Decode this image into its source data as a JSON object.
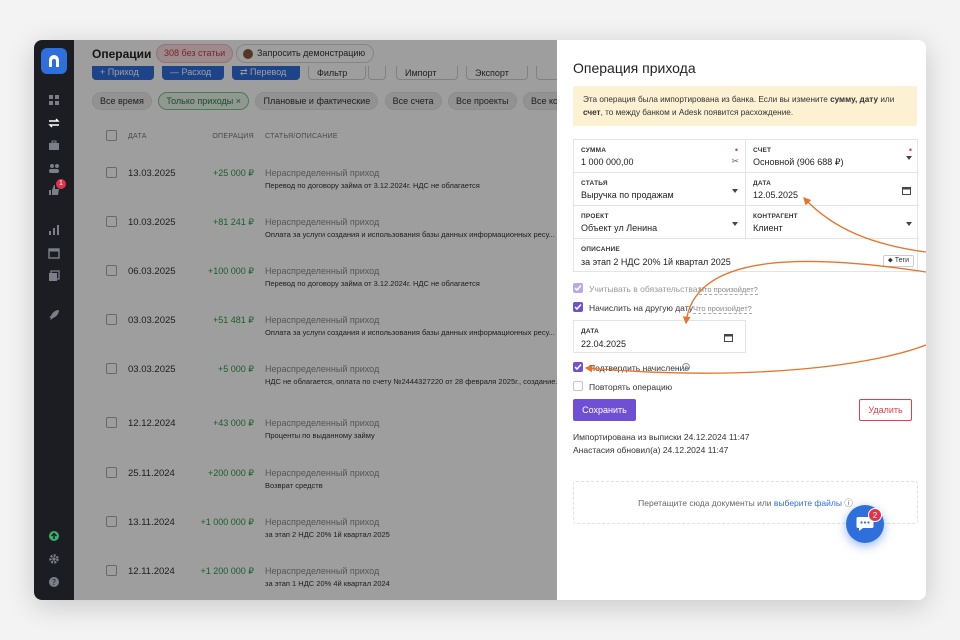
{
  "topbar": {
    "title": "Операции",
    "badge": "308 без статьи",
    "demo_button": "Запросить демонстрацию"
  },
  "toolbar": {
    "buttons": [
      "+ Приход",
      "— Расход",
      "⇄ Перевод",
      "Фильтр",
      "Импорт",
      "Экспорт"
    ]
  },
  "filters": [
    "Все время",
    "Только приходы ×",
    "Плановые и фактические",
    "Все счета",
    "Все проекты",
    "Все контрагенты"
  ],
  "table": {
    "headers": {
      "date": "ДАТА",
      "amount": "ОПЕРАЦИЯ",
      "desc": "СТАТЬЯ/ОПИСАНИЕ"
    },
    "rows": [
      {
        "date": "13.03.2025",
        "amount": "+25 000 ₽",
        "category": "Нераспределенный приход",
        "desc": "Перевод по договору займа от 3.12.2024г. НДС не облагается"
      },
      {
        "date": "10.03.2025",
        "amount": "+81 241 ₽",
        "category": "Нераспределенный приход",
        "desc": "Оплата за услуги создания и использования базы данных информационных ресу..."
      },
      {
        "date": "06.03.2025",
        "amount": "+100 000 ₽",
        "category": "Нераспределенный приход",
        "desc": "Перевод по договору займа от 3.12.2024г. НДС не облагается"
      },
      {
        "date": "03.03.2025",
        "amount": "+51 481 ₽",
        "category": "Нераспределенный приход",
        "desc": "Оплата за услуги создания и использования базы данных информационных ресу..."
      },
      {
        "date": "03.03.2025",
        "amount": "+5 000 ₽",
        "category": "Нераспределенный приход",
        "desc": "НДС не облагается, оплата по счету №2444327220 от 28 февраля 2025г., создание..."
      },
      {
        "date": "12.12.2024",
        "amount": "+43 000 ₽",
        "category": "Нераспределенный приход",
        "desc": "Проценты по выданному займу"
      },
      {
        "date": "25.11.2024",
        "amount": "+200 000 ₽",
        "category": "Нераспределенный приход",
        "desc": "Возврат средств"
      },
      {
        "date": "13.11.2024",
        "amount": "+1 000 000 ₽",
        "category": "Нераспределенный приход",
        "desc": "за этап 2 НДС 20% 1й квартал 2025"
      },
      {
        "date": "12.11.2024",
        "amount": "+1 200 000 ₽",
        "category": "Нераспределенный приход",
        "desc": "за этап 1 НДС 20% 4й квартал 2024"
      }
    ]
  },
  "rail": {
    "badge": "1"
  },
  "panel": {
    "title": "Операция прихода",
    "notice_part1": "Эта операция была импортирована из банка. Если вы измените ",
    "notice_bold1": "сумму, дату",
    "notice_part2": " или ",
    "notice_bold2": "счет",
    "notice_part3": ", то между банком и Adesk появится расхождение.",
    "fields": {
      "amount_label": "СУММА",
      "amount_value": "1 000 000,00",
      "account_label": "СЧЕТ",
      "account_value": "Основной (906 688 ₽)",
      "category_label": "СТАТЬЯ",
      "category_value": "Выручка по продажам",
      "date_label": "ДАТА",
      "date_value": "12.05.2025",
      "project_label": "ПРОЕКТ",
      "project_value": "Объект ул Ленина",
      "contractor_label": "КОНТРАГЕНТ",
      "contractor_value": "Клиент",
      "description_label": "ОПИСАНИЕ",
      "description_value": "за этап 2 НДС 20% 1й квартал 2025",
      "tags_label": "Теги"
    },
    "obligations_label": "Учитывать в обязательствах",
    "what_happens": "Что произойдет?",
    "accrue_label": "Начислить на другую дату",
    "accrual_date_label": "ДАТА",
    "accrual_date_value": "22.04.2025",
    "confirm_label": "Подтвердить начисление",
    "repeat_label": "Повторять операцию",
    "save_label": "Сохранить",
    "delete_label": "Удалить",
    "imported_text": "Импортирована из выписки 24.12.2024 11:47",
    "updated_text": "Анастасия обновил(а) 24.12.2024 11:47",
    "drop_text": "Перетащите сюда документы или ",
    "drop_link": "выберите файлы"
  },
  "chat": {
    "badge": "2"
  },
  "colors": {
    "accent_purple": "#6f4fd3",
    "brand_blue": "#2f6fdc",
    "income_green": "#2a9a48",
    "arrow_orange": "#e8742a",
    "danger": "#d9414b"
  }
}
